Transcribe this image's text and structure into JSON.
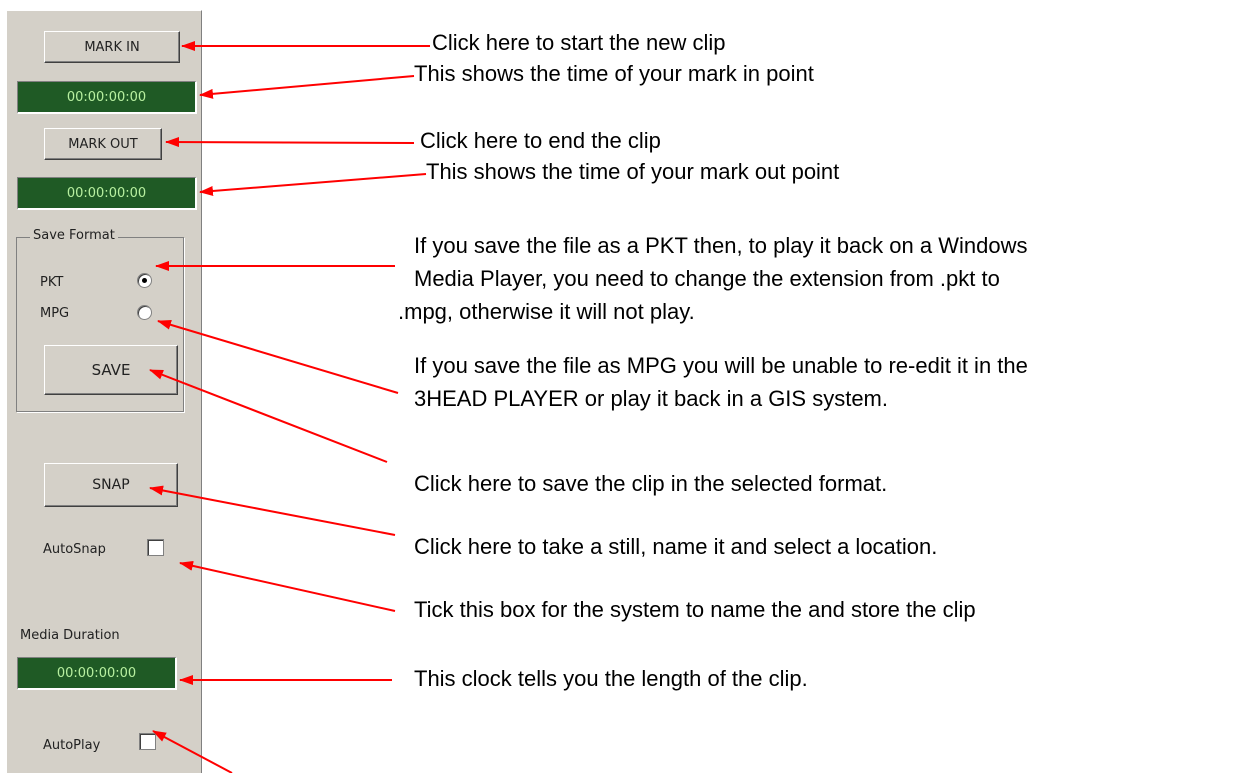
{
  "panel": {
    "mark_in_button": "MARK IN",
    "mark_in_time": "00:00:00:00",
    "mark_out_button": "MARK OUT",
    "mark_out_time": "00:00:00:00",
    "save_format_label": "Save Format",
    "formats": [
      {
        "label": "PKT",
        "selected": true
      },
      {
        "label": "MPG",
        "selected": false
      }
    ],
    "save_button": "SAVE",
    "snap_button": "SNAP",
    "autosnap_label": "AutoSnap",
    "autosnap_checked": false,
    "media_duration_label": "Media Duration",
    "media_duration_time": "00:00:00:00",
    "autoplay_label": "AutoPlay",
    "autoplay_checked": false
  },
  "annotations": {
    "mark_in": "Click here to start the new clip",
    "mark_in_time": "This shows the time of your mark in point",
    "mark_out": "Click here to end the clip",
    "mark_out_time": "This shows the time of your mark out point",
    "pkt_lines": [
      "If you save the file as a PKT then, to play it back on a Windows",
      "Media Player, you need to change the extension from .pkt to",
      ".mpg, otherwise it will not play."
    ],
    "mpg_lines": [
      "If you save the file as MPG you will be unable to re-edit it in the",
      "3HEAD PLAYER or play it back in a GIS system."
    ],
    "save": "Click here to save the clip in the selected format.",
    "snap": "Click here to take a still, name it and select a location.",
    "autosnap": "Tick this box for the system to name the and store the clip",
    "duration": "This clock tells you the length of the clip."
  },
  "colors": {
    "arrow": "#ff0000",
    "clock_bg": "#1f5a25",
    "clock_text": "#b8f0a0",
    "panel_bg": "#d4d0c8"
  }
}
